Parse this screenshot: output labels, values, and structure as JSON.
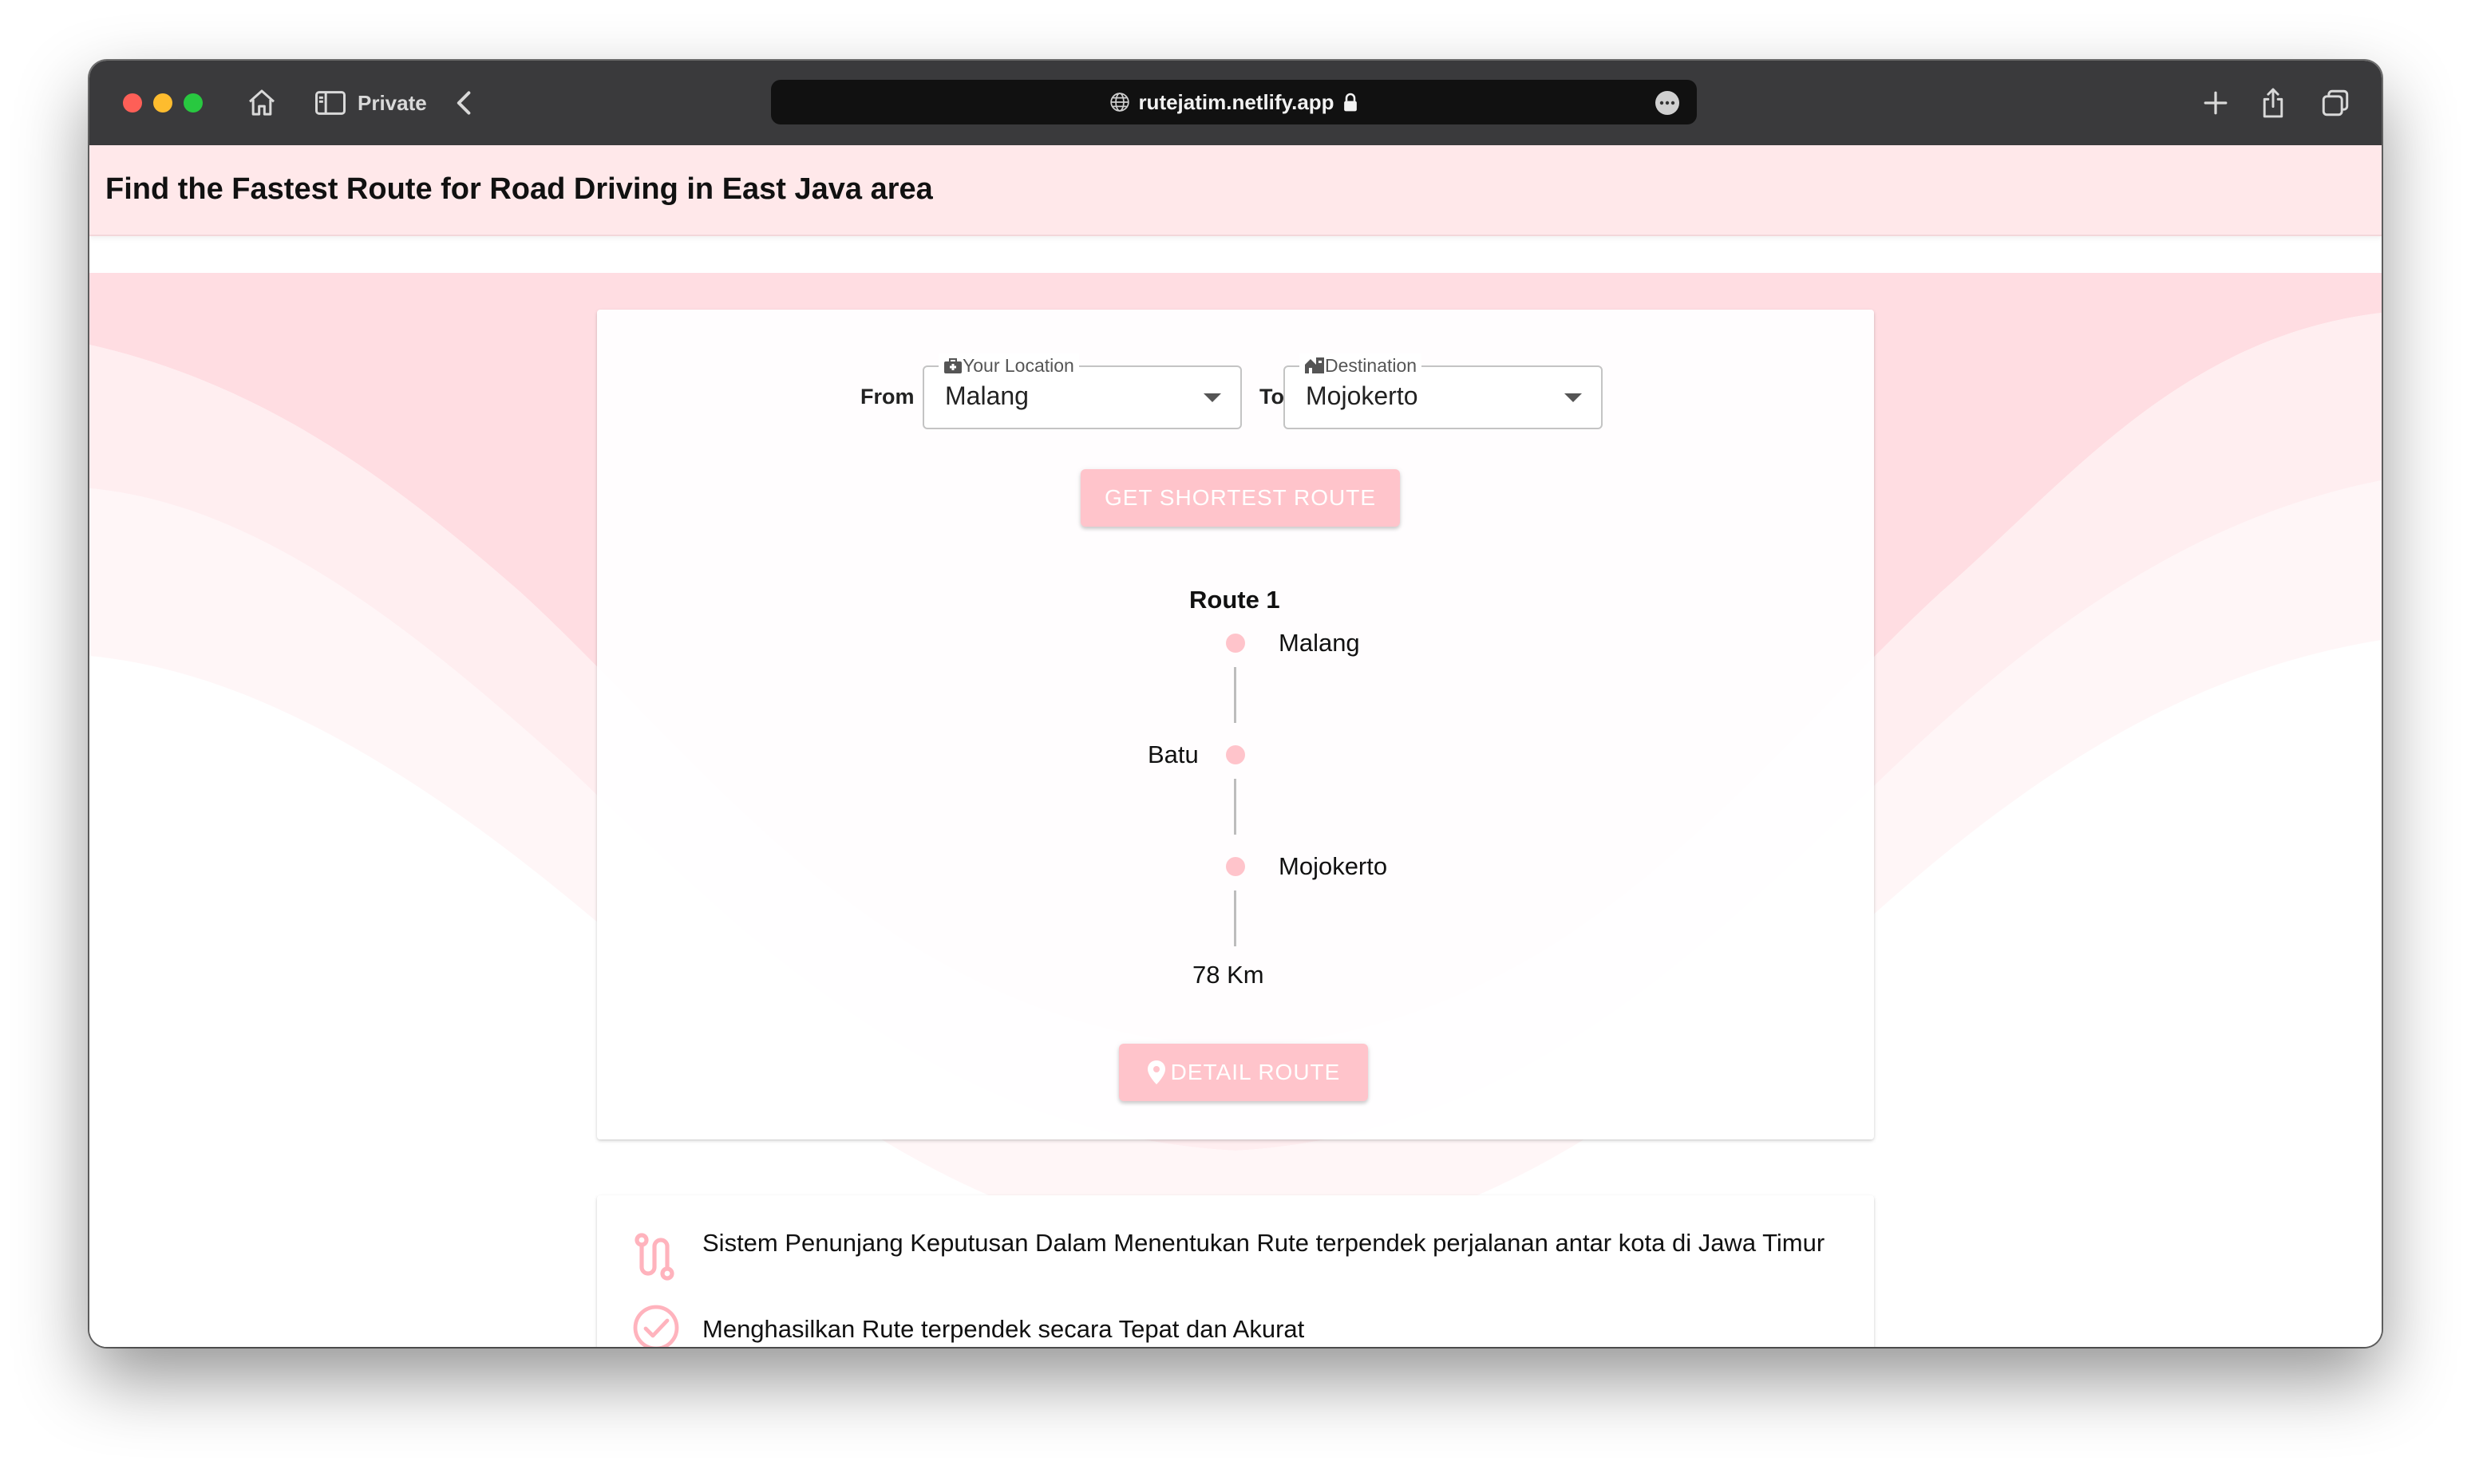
{
  "browser": {
    "private_label": "Private",
    "url": "rutejatim.netlify.app"
  },
  "appbar": {
    "title": "Find the Fastest Route for Road Driving in East Java area"
  },
  "form": {
    "from_label": "From",
    "to_label": "To",
    "origin": {
      "legend": "Your Location",
      "value": "Malang"
    },
    "destination": {
      "legend": "Destination",
      "value": "Mojokerto"
    },
    "submit_label": "GET SHORTEST ROUTE"
  },
  "route": {
    "title": "Route 1",
    "stops": [
      {
        "name": "Malang",
        "side": "right"
      },
      {
        "name": "Batu",
        "side": "left"
      },
      {
        "name": "Mojokerto",
        "side": "right"
      }
    ],
    "distance": "78 Km",
    "detail_label": "DETAIL ROUTE"
  },
  "info": {
    "items": [
      {
        "icon": "route-icon",
        "text": "Sistem Penunjang Keputusan Dalam Menentukan Rute terpendek perjalanan antar kota di Jawa Timur"
      },
      {
        "icon": "check-circle-icon",
        "text": "Menghasilkan Rute terpendek secara Tepat dan Akurat"
      }
    ]
  },
  "colors": {
    "accent": "#ffc4cb",
    "appbar_bg": "#ffe8ea",
    "chrome_bg": "#3a3a3c"
  }
}
